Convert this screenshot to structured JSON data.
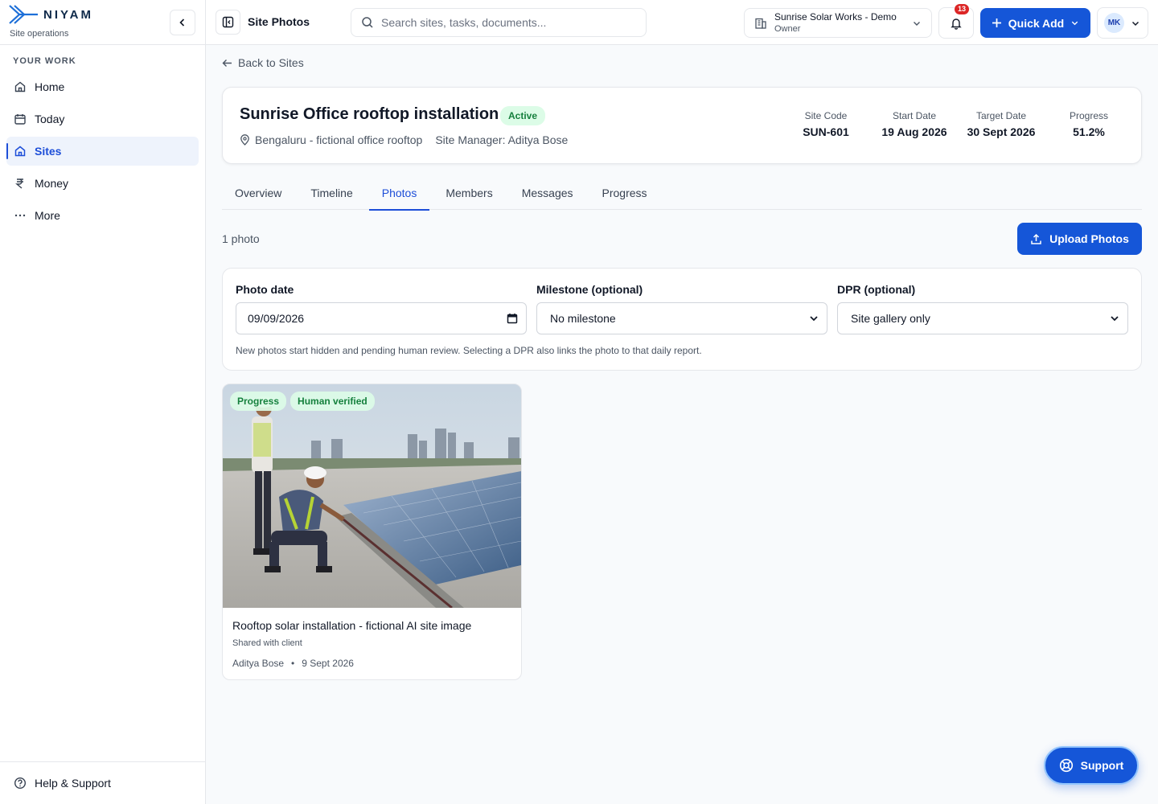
{
  "brand": {
    "name": "NIYAM",
    "subtitle": "Site operations"
  },
  "sidebar": {
    "section_label": "YOUR WORK",
    "items": [
      {
        "label": "Home",
        "icon": "home-icon"
      },
      {
        "label": "Today",
        "icon": "calendar-icon"
      },
      {
        "label": "Sites",
        "icon": "sites-icon",
        "active": true
      },
      {
        "label": "Money",
        "icon": "rupee-icon"
      },
      {
        "label": "More",
        "icon": "more-icon"
      }
    ],
    "help_label": "Help & Support"
  },
  "topbar": {
    "page_title": "Site Photos",
    "search_placeholder": "Search sites, tasks, documents...",
    "org_name": "Sunrise Solar Works - Demo",
    "org_role": "Owner",
    "notification_count": "13",
    "quick_add_label": "Quick Add",
    "user_initials": "MK"
  },
  "back_label": "Back to Sites",
  "site": {
    "title": "Sunrise Office rooftop installation",
    "status": "Active",
    "location": "Bengaluru - fictional office rooftop",
    "manager": "Site Manager: Aditya Bose",
    "stats": [
      {
        "label": "Site Code",
        "value": "SUN-601"
      },
      {
        "label": "Start Date",
        "value": "19 Aug 2026"
      },
      {
        "label": "Target Date",
        "value": "30 Sept 2026"
      },
      {
        "label": "Progress",
        "value": "51.2%"
      }
    ]
  },
  "tabs": [
    {
      "label": "Overview"
    },
    {
      "label": "Timeline"
    },
    {
      "label": "Photos",
      "active": true
    },
    {
      "label": "Members"
    },
    {
      "label": "Messages"
    },
    {
      "label": "Progress"
    }
  ],
  "photos": {
    "count_label": "1 photo",
    "upload_label": "Upload Photos",
    "filters": {
      "date_label": "Photo date",
      "date_value": "09/09/2026",
      "milestone_label": "Milestone (optional)",
      "milestone_value": "No milestone",
      "dpr_label": "DPR (optional)",
      "dpr_value": "Site gallery only",
      "note": "New photos start hidden and pending human review. Selecting a DPR also links the photo to that daily report."
    },
    "items": [
      {
        "tags": [
          "Progress",
          "Human verified"
        ],
        "title": "Rooftop solar installation - fictional AI site image",
        "sharing": "Shared with client",
        "author": "Aditya Bose",
        "date": "9 Sept 2026"
      }
    ]
  },
  "support_label": "Support",
  "colors": {
    "primary": "#1556d8",
    "active_bg": "#eef3fc",
    "success_bg": "#dcfce7",
    "success_text": "#15803d",
    "badge": "#dc2626"
  }
}
